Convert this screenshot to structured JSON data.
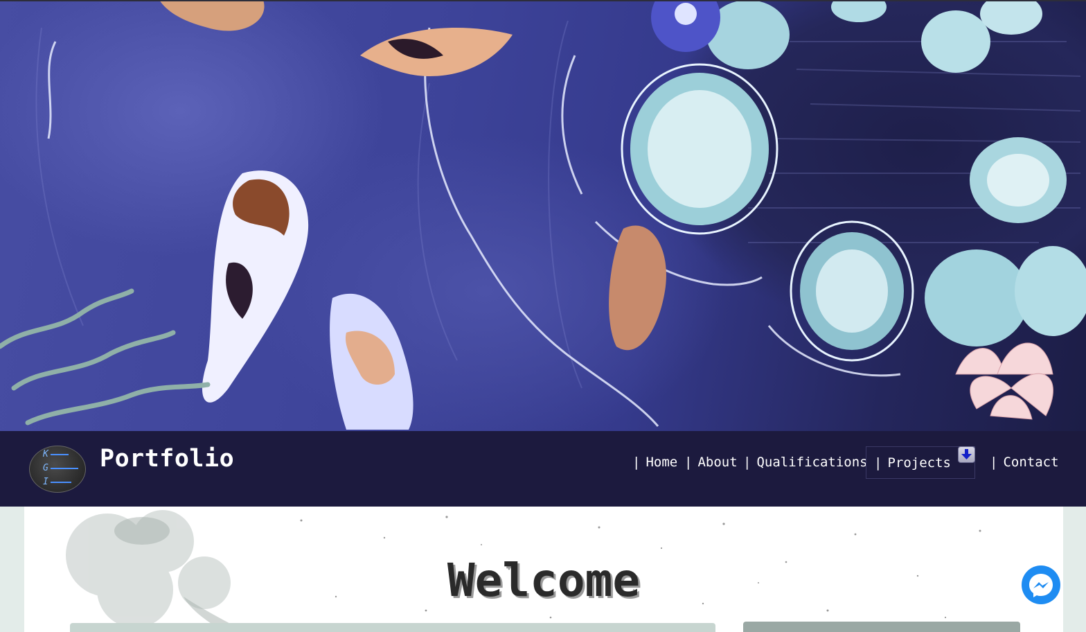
{
  "brand": {
    "title": "Portfolio",
    "logo_letters": [
      "K",
      "G",
      "I"
    ]
  },
  "nav": {
    "separator": "|",
    "items": [
      {
        "label": "Home"
      },
      {
        "label": "About"
      },
      {
        "label": "Qualifications"
      },
      {
        "label": "Projects"
      },
      {
        "label": "Contact"
      }
    ],
    "projects_icon": "download-arrow-icon"
  },
  "main": {
    "heading": "Welcome"
  },
  "widgets": {
    "chat_icon": "messenger-icon"
  },
  "colors": {
    "navbar_bg": "#1c1a3e",
    "nav_text": "#ffffff",
    "messenger_blue": "#1e8cf2",
    "hero_water": "#3d4399"
  }
}
